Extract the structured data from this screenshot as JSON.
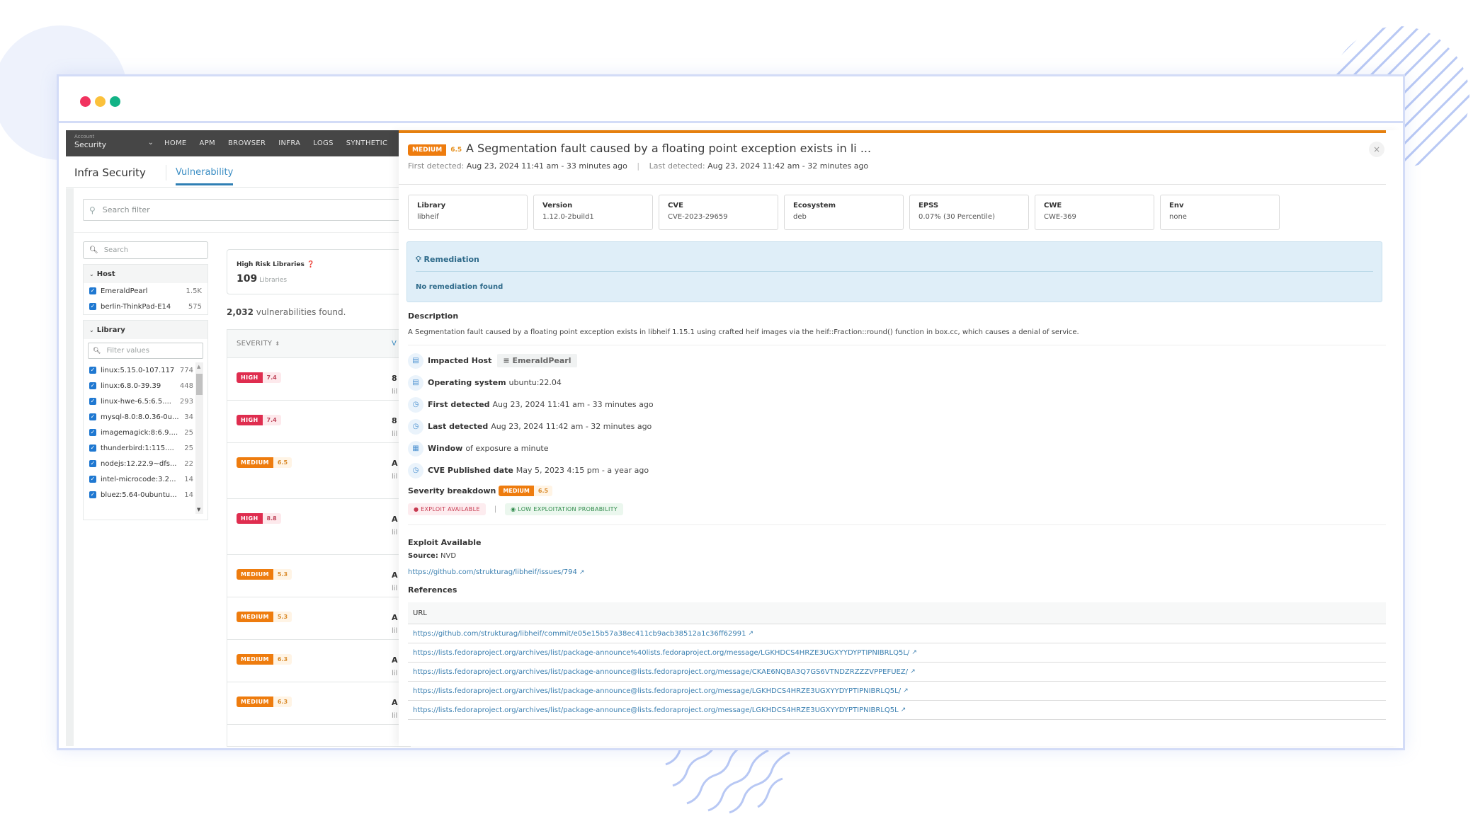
{
  "window": {
    "traffic_lights": [
      "close",
      "minimize",
      "maximize"
    ]
  },
  "topnav": {
    "account_label": "Account",
    "account_value": "Security",
    "items": [
      "HOME",
      "APM",
      "BROWSER",
      "INFRA",
      "LOGS",
      "SYNTHETIC"
    ]
  },
  "subheader": {
    "title": "Infra Security",
    "active_tab": "Vulnerability"
  },
  "search_filter": {
    "placeholder": "Search filter"
  },
  "facets": {
    "search_placeholder": "Search",
    "host": {
      "title": "Host",
      "items": [
        {
          "name": "EmeraldPearl",
          "count": "1.5K",
          "checked": true
        },
        {
          "name": "berlin-ThinkPad-E14",
          "count": "575",
          "checked": true
        }
      ]
    },
    "library": {
      "title": "Library",
      "filter_placeholder": "Filter values",
      "items": [
        {
          "name": "linux:5.15.0-107.117",
          "count": "774",
          "checked": true
        },
        {
          "name": "linux:6.8.0-39.39",
          "count": "448",
          "checked": true
        },
        {
          "name": "linux-hwe-6.5:6.5....",
          "count": "293",
          "checked": true
        },
        {
          "name": "mysql-8.0:8.0.36-0u...",
          "count": "34",
          "checked": true
        },
        {
          "name": "imagemagick:8:6.9....",
          "count": "25",
          "checked": true
        },
        {
          "name": "thunderbird:1:115....",
          "count": "25",
          "checked": true
        },
        {
          "name": "nodejs:12.22.9~dfs...",
          "count": "22",
          "checked": true
        },
        {
          "name": "intel-microcode:3.2...",
          "count": "14",
          "checked": true
        },
        {
          "name": "bluez:5.64-0ubuntu...",
          "count": "14",
          "checked": true
        }
      ]
    }
  },
  "summary": {
    "label": "High Risk Libraries",
    "value": "109",
    "unit": "Libraries"
  },
  "found": {
    "count": "2,032",
    "text": "vulnerabilities found."
  },
  "vuln_table": {
    "columns": [
      "SEVERITY",
      "V"
    ],
    "rows": [
      {
        "severity": "HIGH",
        "score": "7.4",
        "peek": "8",
        "peek2": "lil"
      },
      {
        "severity": "HIGH",
        "score": "7.4",
        "peek": "8",
        "peek2": "lil"
      },
      {
        "severity": "MEDIUM",
        "score": "6.5",
        "peek": "A",
        "peek2": "lil"
      },
      {
        "severity": "HIGH",
        "score": "8.8",
        "peek": "A",
        "peek2": "lil"
      },
      {
        "severity": "MEDIUM",
        "score": "5.3",
        "peek": "A",
        "peek2": "lil"
      },
      {
        "severity": "MEDIUM",
        "score": "5.3",
        "peek": "A",
        "peek2": "lil"
      },
      {
        "severity": "MEDIUM",
        "score": "6.3",
        "peek": "A",
        "peek2": "lil"
      },
      {
        "severity": "MEDIUM",
        "score": "6.3",
        "peek": "A",
        "peek2": "lil"
      }
    ]
  },
  "detail": {
    "severity": "MEDIUM",
    "score": "6.5",
    "title": "A Segmentation fault caused by a floating point exception exists in li ...",
    "first_detected_label": "First detected:",
    "first_detected": "Aug 23, 2024 11:41 am - 33 minutes ago",
    "last_detected_label": "Last detected:",
    "last_detected": "Aug 23, 2024 11:42 am - 32 minutes ago",
    "close_label": "×",
    "attributes": [
      {
        "key": "Library",
        "value": "libheif"
      },
      {
        "key": "Version",
        "value": "1.12.0-2build1"
      },
      {
        "key": "CVE",
        "value": "CVE-2023-29659"
      },
      {
        "key": "Ecosystem",
        "value": "deb"
      },
      {
        "key": "EPSS",
        "value": "0.07% (30 Percentile)"
      },
      {
        "key": "CWE",
        "value": "CWE-369"
      },
      {
        "key": "Env",
        "value": "none"
      }
    ],
    "remediation": {
      "title": "Remediation",
      "message": "No remediation found"
    },
    "description_title": "Description",
    "description": "A Segmentation fault caused by a floating point exception exists in libheif 1.15.1 using crafted heif images via the heif::Fraction::round() function in box.cc, which causes a denial of service.",
    "meta": [
      {
        "icon": "server-icon",
        "label": "Impacted Host",
        "value": "",
        "chip": "EmeraldPearl"
      },
      {
        "icon": "server-icon",
        "label": "Operating system",
        "value": "ubuntu:22.04"
      },
      {
        "icon": "clock-icon",
        "label": "First detected",
        "value": "Aug 23, 2024 11:41 am - 33 minutes ago"
      },
      {
        "icon": "clock-icon",
        "label": "Last detected",
        "value": "Aug 23, 2024 11:42 am - 32 minutes ago"
      },
      {
        "icon": "calendar-icon",
        "label": "Window",
        "value": "of exposure a minute"
      },
      {
        "icon": "clock-icon",
        "label": "CVE Published date",
        "value": "May 5, 2023 4:15 pm - a year ago"
      }
    ],
    "severity_breakdown": {
      "label": "Severity breakdown",
      "severity": "MEDIUM",
      "score": "6.5",
      "exploit_chip": "EXPLOIT AVAILABLE",
      "probability_chip": "LOW EXPLOITATION PROBABILITY"
    },
    "exploit": {
      "title": "Exploit Available",
      "source_label": "Source:",
      "source": "NVD",
      "link": "https://github.com/strukturag/libheif/issues/794"
    },
    "references": {
      "title": "References",
      "column": "URL",
      "urls": [
        "https://github.com/strukturag/libheif/commit/e05e15b57a38ec411cb9acb38512a1c36ff62991",
        "https://lists.fedoraproject.org/archives/list/package-announce%40lists.fedoraproject.org/message/LGKHDCS4HRZE3UGXYYDYPTIPNIBRLQ5L/",
        "https://lists.fedoraproject.org/archives/list/package-announce@lists.fedoraproject.org/message/CKAE6NQBA3Q7GS6VTNDZRZZZVPPEFUEZ/",
        "https://lists.fedoraproject.org/archives/list/package-announce@lists.fedoraproject.org/message/LGKHDCS4HRZE3UGXYYDYPTIPNIBRLQ5L/",
        "https://lists.fedoraproject.org/archives/list/package-announce@lists.fedoraproject.org/message/LGKHDCS4HRZE3UGXYYDYPTIPNIBRLQ5L"
      ]
    }
  },
  "colors": {
    "high": "#df2d4f",
    "medium": "#ee7c0e",
    "accent_blue": "#3c8ec4",
    "link": "#3a7fb0",
    "remediation_bg": "#dfeef8",
    "nav_bg": "#464646"
  }
}
